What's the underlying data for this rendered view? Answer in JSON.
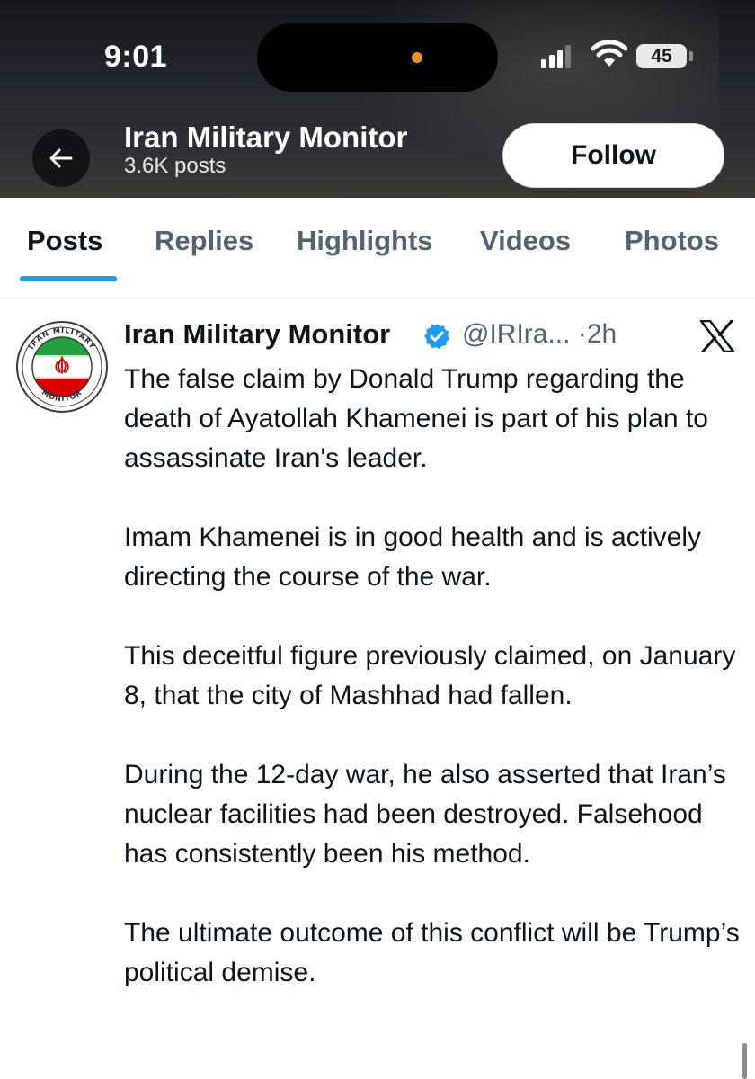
{
  "status_bar": {
    "time": "9:01",
    "battery": "45",
    "signal_icon": "cellular-signal-icon",
    "wifi_icon": "wifi-icon"
  },
  "profile_header": {
    "back_icon": "arrow-left-icon",
    "name": "Iran Military Monitor",
    "posts_count": "3.6K posts",
    "follow_label": "Follow"
  },
  "tabs": [
    {
      "label": "Posts",
      "active": true
    },
    {
      "label": "Replies",
      "active": false
    },
    {
      "label": "Highlights",
      "active": false
    },
    {
      "label": "Videos",
      "active": false
    },
    {
      "label": "Photos",
      "active": false
    }
  ],
  "post": {
    "avatar_text": {
      "top": "IRAN MILITARY",
      "bottom": "MONITOR"
    },
    "author_name": "Iran Military Monitor",
    "verified_icon": "verified-badge-icon",
    "handle": "@IRIra...",
    "separator": "·",
    "time": "2h",
    "source_icon": "x-logo-icon",
    "paragraphs": [
      "The false claim by Donald Trump regarding the death of Ayatollah Khamenei is part of his plan to assassinate Iran's leader.",
      "Imam Khamenei is in good health and is actively directing the course of the war.",
      "This deceitful figure previously claimed, on January 8, that the city of Mashhad had fallen.",
      "During the 12-day war, he also asserted that Iran’s nuclear facilities had been destroyed. Falsehood has consistently been his method.",
      "The ultimate outcome of this conflict will be Trump’s political demise."
    ]
  },
  "colors": {
    "accent": "#1d9bf0",
    "text_primary": "#0f1419",
    "text_secondary": "#536471",
    "header_bg": "#23262c",
    "flag_green": "#239f40",
    "flag_red": "#da0000"
  }
}
